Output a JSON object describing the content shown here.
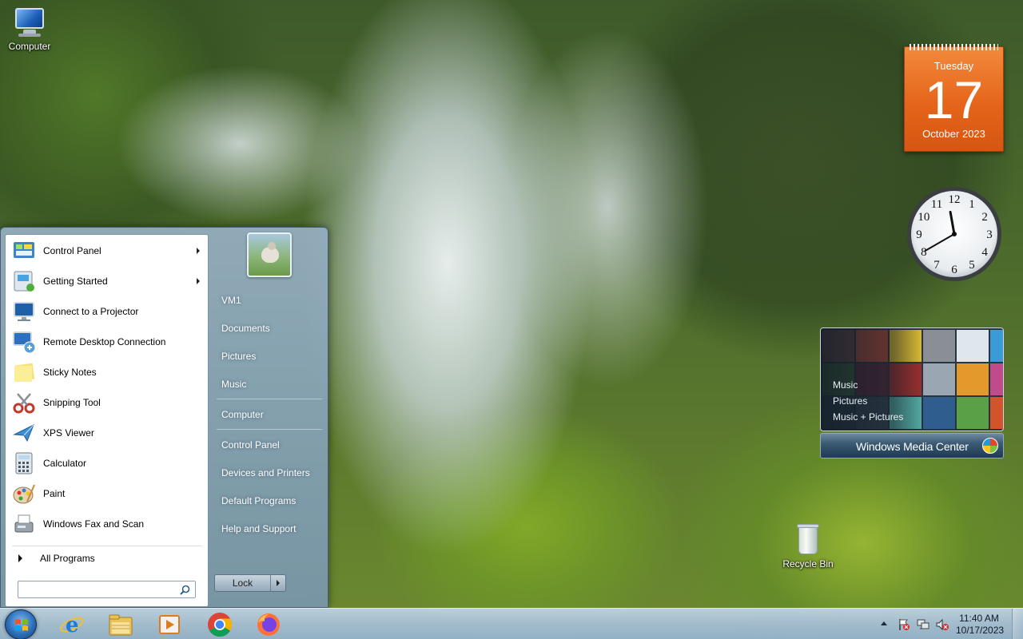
{
  "desktop": {
    "icons": [
      {
        "label": "Computer",
        "icon": "computer-icon"
      },
      {
        "label": "Recycle Bin",
        "icon": "recycle-bin-icon"
      }
    ]
  },
  "gadgets": {
    "calendar": {
      "weekday": "Tuesday",
      "day": "17",
      "month_year": "October 2023"
    },
    "clock": {
      "hour": 11,
      "minute": 40,
      "numerals": [
        "12",
        "1",
        "2",
        "3",
        "4",
        "5",
        "6",
        "7",
        "8",
        "9",
        "10",
        "11"
      ]
    },
    "media_center": {
      "options": [
        "Music",
        "Pictures",
        "Music + Pictures"
      ],
      "title": "Windows Media Center"
    }
  },
  "start_menu": {
    "programs": [
      {
        "label": "Control Panel",
        "has_submenu": true,
        "icon": "control-panel-icon"
      },
      {
        "label": "Getting Started",
        "has_submenu": true,
        "icon": "getting-started-icon"
      },
      {
        "label": "Connect to a Projector",
        "has_submenu": false,
        "icon": "projector-icon"
      },
      {
        "label": "Remote Desktop Connection",
        "has_submenu": false,
        "icon": "remote-desktop-icon"
      },
      {
        "label": "Sticky Notes",
        "has_submenu": false,
        "icon": "sticky-notes-icon"
      },
      {
        "label": "Snipping Tool",
        "has_submenu": false,
        "icon": "scissors-icon"
      },
      {
        "label": "XPS Viewer",
        "has_submenu": false,
        "icon": "xps-viewer-icon"
      },
      {
        "label": "Calculator",
        "has_submenu": false,
        "icon": "calculator-icon"
      },
      {
        "label": "Paint",
        "has_submenu": false,
        "icon": "paint-palette-icon"
      },
      {
        "label": "Windows Fax and Scan",
        "has_submenu": false,
        "icon": "fax-icon"
      }
    ],
    "all_programs": "All Programs",
    "search": {
      "value": "",
      "placeholder": ""
    },
    "right_links": [
      "VM1",
      "Documents",
      "Pictures",
      "Music",
      "Computer",
      "Control Panel",
      "Devices and Printers",
      "Default Programs",
      "Help and Support"
    ],
    "lock_label": "Lock"
  },
  "taskbar": {
    "pinned": [
      {
        "name": "internet-explorer-icon"
      },
      {
        "name": "file-explorer-icon"
      },
      {
        "name": "media-player-icon"
      },
      {
        "name": "chrome-icon"
      },
      {
        "name": "firefox-icon"
      }
    ],
    "tray_icons": [
      "action-center-icon",
      "network-icon",
      "volume-muted-icon"
    ],
    "time": "11:40 AM",
    "date": "10/17/2023"
  },
  "colors": {
    "calendar_orange": "#e5651a",
    "taskbar": "#a8c0d6",
    "start_orb": "#2d6fb8"
  }
}
